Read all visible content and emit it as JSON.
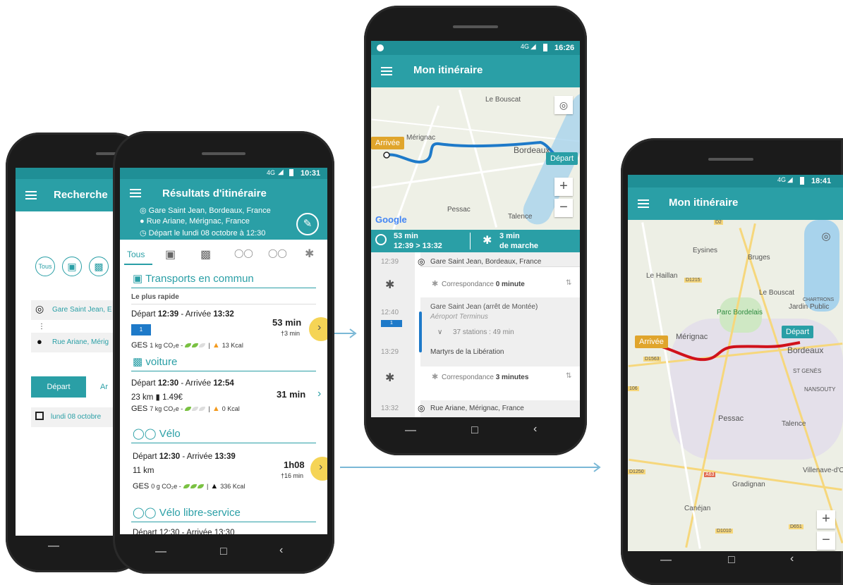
{
  "phone_search": {
    "title": "Recherche",
    "mode_all": "Tous",
    "from": "Gare Saint Jean, E",
    "to": "Rue Ariane, Mérig",
    "depart_btn": "Départ",
    "arrive_btn": "Ar",
    "date": "lundi 08 octobre"
  },
  "phone_results": {
    "status_time": "10:31",
    "status_net": "4G",
    "title": "Résultats d'itinéraire",
    "from": "Gare Saint Jean, Bordeaux, France",
    "to": "Rue Ariane, Mérignac, France",
    "depart": "Départ le lundi 08 octobre  à  12:30",
    "tabs": [
      "Tous"
    ],
    "sections": {
      "transit": {
        "title": "Transports en commun",
        "sublabel": "Le plus rapide",
        "dep_label": "Départ ",
        "dep_time": "12:39",
        "arr_label": " - Arrivée ",
        "arr_time": "13:32",
        "duration": "53  min",
        "walk": "3 min",
        "line": "1",
        "ges_label": "GES",
        "ges_value": "1 kg CO₂e -",
        "kcal": "13 Kcal"
      },
      "car": {
        "title": "voiture",
        "dep_label": "Départ ",
        "dep_time": "12:30",
        "arr_label": " - Arrivée ",
        "arr_time": "12:54",
        "distance": "23 km",
        "fuel": "1.49€",
        "duration": "31 min",
        "ges_label": "GES",
        "ges_value": "7 kg CO₂e -",
        "kcal": "0 Kcal"
      },
      "bike": {
        "title": "Vélo",
        "dep_label": "Départ ",
        "dep_time": "12:30",
        "arr_label": " - Arrivée ",
        "arr_time": "13:39",
        "distance": "11 km",
        "duration": "1h08",
        "walk": "16 min",
        "ges_label": "GES",
        "ges_value": "0 g CO₂e -",
        "kcal": "336 Kcal"
      },
      "bikeshare": {
        "title": "Vélo libre-service",
        "dep_partial": "Départ 12:30 - Arrivée 13:30"
      }
    }
  },
  "phone_itinerary": {
    "status_time": "16:26",
    "status_net": "4G",
    "title": "Mon itinéraire",
    "map_labels": {
      "le_bouscat": "Le Bouscat",
      "merignac": "Mérignac",
      "bordeaux": "Bordeaux",
      "pessac": "Pessac",
      "talence": "Talence",
      "google": "Google"
    },
    "badge_arrival": "Arrivée",
    "badge_departure": "Départ",
    "summary_duration": "53 min",
    "summary_times": "12:39 > 13:32",
    "summary_walk": "3 min",
    "summary_walk_label": "de marche",
    "steps": [
      {
        "time": "12:39",
        "text": "Gare Saint Jean, Bordeaux, France"
      },
      {
        "time": "",
        "text": "Correspondance ",
        "bold": "0 minute"
      },
      {
        "time": "12:40",
        "text": "Gare Saint Jean (arrêt de Montée)",
        "sub": "Aéroport Terminus",
        "line": "1"
      },
      {
        "time": "",
        "text": "37 stations : 49 min"
      },
      {
        "time": "13:29",
        "text": "Martyrs de la Libération"
      },
      {
        "time": "",
        "text": "Correspondance ",
        "bold": "3 minutes"
      },
      {
        "time": "13:32",
        "text": "Rue Ariane, Mérignac, France"
      }
    ]
  },
  "phone_map": {
    "status_time": "18:41",
    "status_net": "4G",
    "title": "Mon itinéraire",
    "badge_arrival": "Arrivée",
    "badge_departure": "Départ",
    "labels": {
      "eysines": "Eysines",
      "bruges": "Bruges",
      "le_haillan": "Le Haillan",
      "le_bouscat": "Le Bouscat",
      "jardin_public": "Jardin Public",
      "parc_bordelais": "Parc Bordelais",
      "chartrons": "CHARTRONS",
      "merignac": "Mérignac",
      "bordeaux": "Bordeaux",
      "st_genes": "ST GENÈS",
      "nansouty": "NANSOUTY",
      "pessac": "Pessac",
      "talence": "Talence",
      "villenave": "Villenave-d'O",
      "gradignan": "Gradignan",
      "canejan": "Canéjan",
      "d2": "D2",
      "d1215": "D1215",
      "d1563": "D1563",
      "d1250": "D1250",
      "a63": "A63",
      "d1010": "D1010",
      "d651": "D651",
      "d106": "106"
    }
  },
  "colors": {
    "teal": "#2a9fa6",
    "teal_dark": "#1f8f96",
    "route_blue": "#1e7ac9",
    "route_red": "#d0111b",
    "highlight": "#f4cf44"
  }
}
